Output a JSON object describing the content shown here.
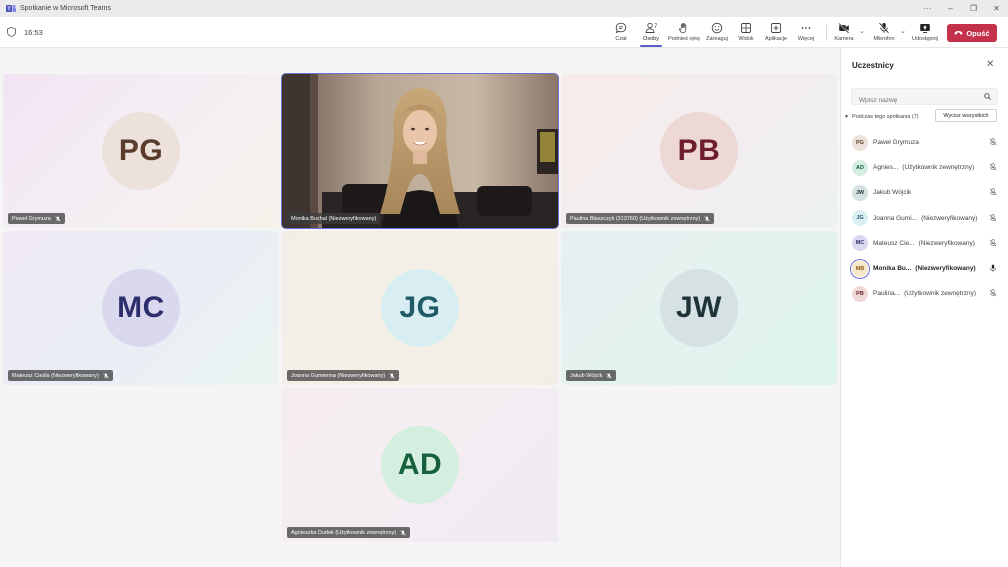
{
  "window": {
    "title": "Spotkanie w Microsoft Teams",
    "controls": [
      "···",
      "–",
      "❐",
      "✕"
    ]
  },
  "toolbar": {
    "timer": "16:53",
    "people_count": "7",
    "buttons": [
      {
        "id": "chat",
        "label": "Czat",
        "icon": "chat-icon"
      },
      {
        "id": "people",
        "label": "Osoby",
        "icon": "people-icon"
      },
      {
        "id": "raise",
        "label": "Podnieś rękę",
        "icon": "hand-icon"
      },
      {
        "id": "react",
        "label": "Zareaguj",
        "icon": "smile-icon"
      },
      {
        "id": "view",
        "label": "Widok",
        "icon": "grid-icon"
      },
      {
        "id": "apps",
        "label": "Aplikacje",
        "icon": "plus-icon"
      },
      {
        "id": "more",
        "label": "Więcej",
        "icon": "more-icon"
      },
      {
        "id": "camera",
        "label": "Kamera",
        "icon": "camera-off-icon"
      },
      {
        "id": "mic",
        "label": "Mikrofon",
        "icon": "mic-off-icon"
      },
      {
        "id": "share",
        "label": "Udostępnij",
        "icon": "share-icon"
      }
    ],
    "leave_label": "Opuść",
    "accent": "#5b5fc7",
    "leave_color": "#c4314b"
  },
  "tiles": [
    {
      "initials": "PG",
      "name": "Paweł Grymuza"
    },
    {
      "initials": "",
      "name": "Monika Buchal (Niezweryfikowany)",
      "video": true,
      "speaking": true
    },
    {
      "initials": "PB",
      "name": "Paulina Błaszczyk (313760) (Użytkownik zewnętrzny)"
    },
    {
      "initials": "MC",
      "name": "Mateusz Cieśla (Niezweryfikowany)"
    },
    {
      "initials": "JG",
      "name": "Joanna Gumienna (Niezweryfikowany)"
    },
    {
      "initials": "JW",
      "name": "Jakub Wójcik"
    },
    {
      "initials": "AD",
      "name": "Agnieszka Dudek (Użytkownik zewnętrzny)"
    }
  ],
  "panel": {
    "title": "Uczestnicy",
    "search_placeholder": "Wpisz nazwę",
    "section_label": "Podczas tego spotkania (7)",
    "mute_all_label": "Wycisz wszystkich",
    "participants": [
      {
        "initials": "PG",
        "name": "Paweł Grymuza",
        "suffix": "",
        "muted": true
      },
      {
        "initials": "AD",
        "name": "Agnies...",
        "suffix": "(Użytkownik zewnętrzny)",
        "muted": true
      },
      {
        "initials": "JW",
        "name": "Jakub Wójcik",
        "suffix": "",
        "muted": true
      },
      {
        "initials": "JG",
        "name": "Joanna Gumi...",
        "suffix": "(Niezweryfikowany)",
        "muted": true
      },
      {
        "initials": "MC",
        "name": "Mateusz Cie...",
        "suffix": "(Niezweryfikowany)",
        "muted": true
      },
      {
        "initials": "MB",
        "name": "Monika Bu...",
        "suffix": "(Niezweryfikowany)",
        "muted": false,
        "active": true
      },
      {
        "initials": "PB",
        "name": "Paulina...",
        "suffix": "(Użytkownik zewnętrzny)",
        "muted": true
      }
    ]
  }
}
